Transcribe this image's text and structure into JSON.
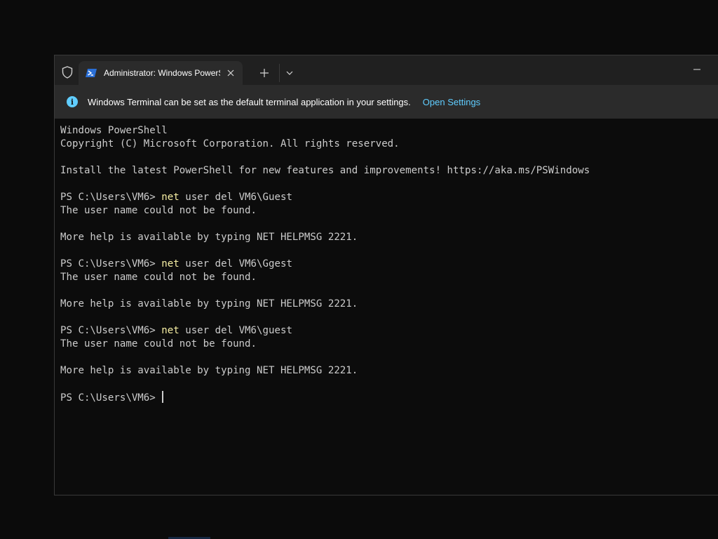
{
  "window": {
    "tab_title": "Administrator: Windows PowerShell",
    "tab_icon": "powershell-icon",
    "shield_icon": "shield-icon",
    "close_icon": "close-icon",
    "new_tab_icon": "plus-icon",
    "dropdown_icon": "chevron-down-icon",
    "minimize_icon": "minimize-icon"
  },
  "infobar": {
    "icon": "info-icon",
    "message": "Windows Terminal can be set as the default terminal application in your settings.",
    "link_label": "Open Settings"
  },
  "terminal": {
    "lines": [
      {
        "type": "text",
        "text": "Windows PowerShell"
      },
      {
        "type": "text",
        "text": "Copyright (C) Microsoft Corporation. All rights reserved."
      },
      {
        "type": "text",
        "text": ""
      },
      {
        "type": "text",
        "text": "Install the latest PowerShell for new features and improvements! https://aka.ms/PSWindows"
      },
      {
        "type": "text",
        "text": ""
      },
      {
        "type": "prompt",
        "prompt": "PS C:\\Users\\VM6> ",
        "command": "net",
        "args": " user del VM6\\Guest"
      },
      {
        "type": "text",
        "text": "The user name could not be found."
      },
      {
        "type": "text",
        "text": ""
      },
      {
        "type": "text",
        "text": "More help is available by typing NET HELPMSG 2221."
      },
      {
        "type": "text",
        "text": ""
      },
      {
        "type": "prompt",
        "prompt": "PS C:\\Users\\VM6> ",
        "command": "net",
        "args": " user del VM6\\Ggest"
      },
      {
        "type": "text",
        "text": "The user name could not be found."
      },
      {
        "type": "text",
        "text": ""
      },
      {
        "type": "text",
        "text": "More help is available by typing NET HELPMSG 2221."
      },
      {
        "type": "text",
        "text": ""
      },
      {
        "type": "prompt",
        "prompt": "PS C:\\Users\\VM6> ",
        "command": "net",
        "args": " user del VM6\\guest"
      },
      {
        "type": "text",
        "text": "The user name could not be found."
      },
      {
        "type": "text",
        "text": ""
      },
      {
        "type": "text",
        "text": "More help is available by typing NET HELPMSG 2221."
      },
      {
        "type": "text",
        "text": ""
      },
      {
        "type": "active",
        "prompt": "PS C:\\Users\\VM6> "
      }
    ]
  },
  "colors": {
    "background": "#0c0c0c",
    "text": "#cccccc",
    "command": "#f9f1a5",
    "link": "#60cdff",
    "titlebar": "#202020",
    "tab": "#2b2b2b"
  }
}
